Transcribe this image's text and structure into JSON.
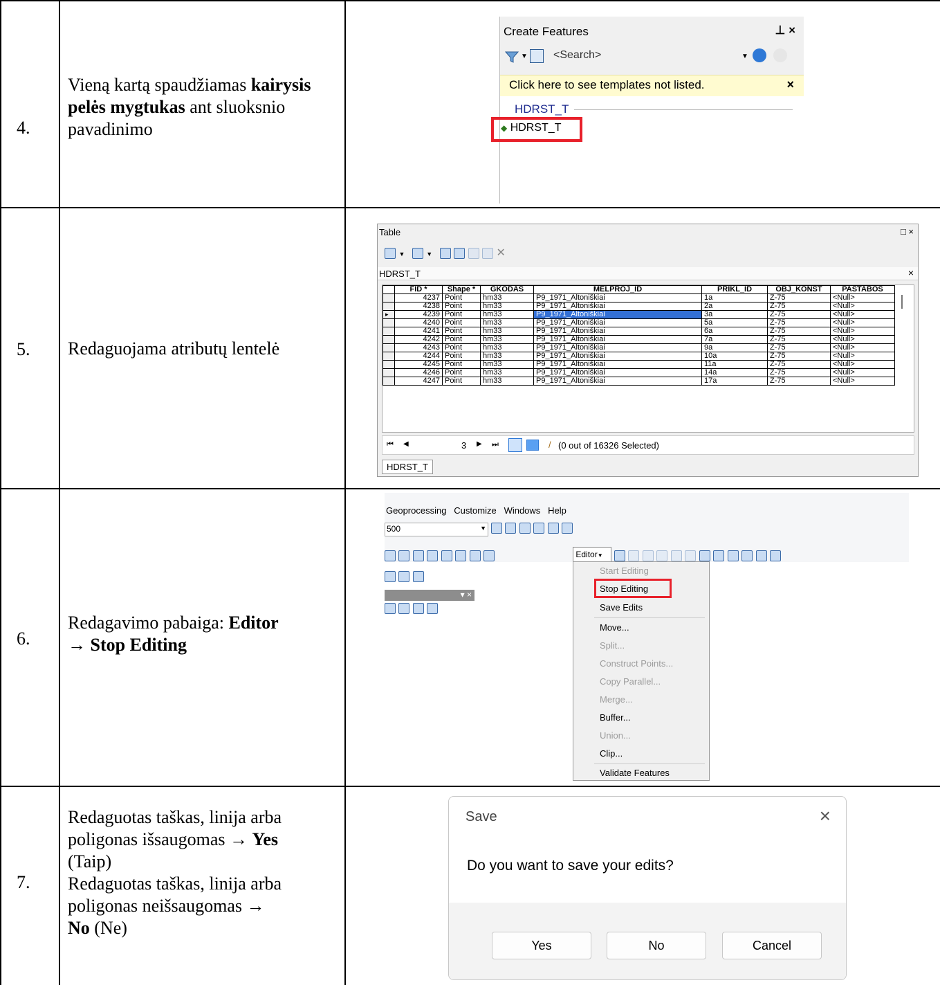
{
  "rows": [
    {
      "num": "4.",
      "desc_a": "Vieną kartą spaudžiamas ",
      "desc_b": "kairysis pelės mygtukas",
      "desc_c": " ant sluoksnio pavadinimo"
    },
    {
      "num": "5.",
      "desc": "Redaguojama atributų lentelė"
    },
    {
      "num": "6.",
      "desc_a": "Redagavimo pabaiga: ",
      "desc_b": "Editor",
      "desc_c": "→ Stop Editing"
    },
    {
      "num": "7.",
      "desc_a": "Redaguotas taškas, linija arba poligonas išsaugomas → ",
      "desc_b": "Yes",
      "desc_c": "(Taip)",
      "desc_d": "Redaguotas taškas, linija arba poligonas neišsaugomas →",
      "desc_e": "No",
      "desc_f": " (Ne)"
    }
  ],
  "create_features": {
    "title": "Create Features",
    "pin": "⊥ ×",
    "search_placeholder": "<Search>",
    "notice": "Click here to see templates not listed.",
    "notice_close": "×",
    "group": "HDRST_T",
    "template": "HDRST_T"
  },
  "table_window": {
    "title": "Table",
    "layer_tab": "HDRST_T",
    "bottom_tab": "HDRST_T",
    "columns": [
      "FID *",
      "Shape *",
      "GKODAS",
      "MELPROJ_ID",
      "PRIKL_ID",
      "OBJ_KONST",
      "PASTABOS"
    ],
    "rows": [
      [
        "4237",
        "Point",
        "hm33",
        "P9_1971_Altoniškiai",
        "1a",
        "Z-75",
        "<Null>"
      ],
      [
        "4238",
        "Point",
        "hm33",
        "P9_1971_Altoniškiai",
        "2a",
        "Z-75",
        "<Null>"
      ],
      [
        "4239",
        "Point",
        "hm33",
        "P9_1971_Altoniškiai",
        "3a",
        "Z-75",
        "<Null>"
      ],
      [
        "4240",
        "Point",
        "hm33",
        "P9_1971_Altoniškiai",
        "5a",
        "Z-75",
        "<Null>"
      ],
      [
        "4241",
        "Point",
        "hm33",
        "P9_1971_Altoniškiai",
        "6a",
        "Z-75",
        "<Null>"
      ],
      [
        "4242",
        "Point",
        "hm33",
        "P9_1971_Altoniškiai",
        "7a",
        "Z-75",
        "<Null>"
      ],
      [
        "4243",
        "Point",
        "hm33",
        "P9_1971_Altoniškiai",
        "9a",
        "Z-75",
        "<Null>"
      ],
      [
        "4244",
        "Point",
        "hm33",
        "P9_1971_Altoniškiai",
        "10a",
        "Z-75",
        "<Null>"
      ],
      [
        "4245",
        "Point",
        "hm33",
        "P9_1971_Altoniškiai",
        "11a",
        "Z-75",
        "<Null>"
      ],
      [
        "4246",
        "Point",
        "hm33",
        "P9_1971_Altoniškiai",
        "14a",
        "Z-75",
        "<Null>"
      ],
      [
        "4247",
        "Point",
        "hm33",
        "P9_1971_Altoniškiai",
        "17a",
        "Z-75",
        "<Null>"
      ]
    ],
    "current_record": "3",
    "selection_status": "(0 out of 16326 Selected)"
  },
  "editor_menu": {
    "menubar": [
      "Geoprocessing",
      "Customize",
      "Windows",
      "Help"
    ],
    "scale": "500",
    "editor_button": "Editor",
    "items": [
      {
        "label": "Start Editing",
        "enabled": false
      },
      {
        "label": "Stop Editing",
        "enabled": true
      },
      {
        "label": "Save Edits",
        "enabled": true
      },
      {
        "label": "Move...",
        "enabled": true
      },
      {
        "label": "Split...",
        "enabled": false
      },
      {
        "label": "Construct Points...",
        "enabled": false
      },
      {
        "label": "Copy Parallel...",
        "enabled": false
      },
      {
        "label": "Merge...",
        "enabled": false
      },
      {
        "label": "Buffer...",
        "enabled": true
      },
      {
        "label": "Union...",
        "enabled": false
      },
      {
        "label": "Clip...",
        "enabled": true
      },
      {
        "label": "Validate Features",
        "enabled": true
      }
    ]
  },
  "save_dialog": {
    "title": "Save",
    "close": "×",
    "message": "Do you want to save your edits?",
    "yes": "Yes",
    "no": "No",
    "cancel": "Cancel"
  },
  "colors": {
    "highlight_box": "#e8212b",
    "selection_blue": "#3370d6",
    "notice_yellow": "#fffbd0"
  }
}
